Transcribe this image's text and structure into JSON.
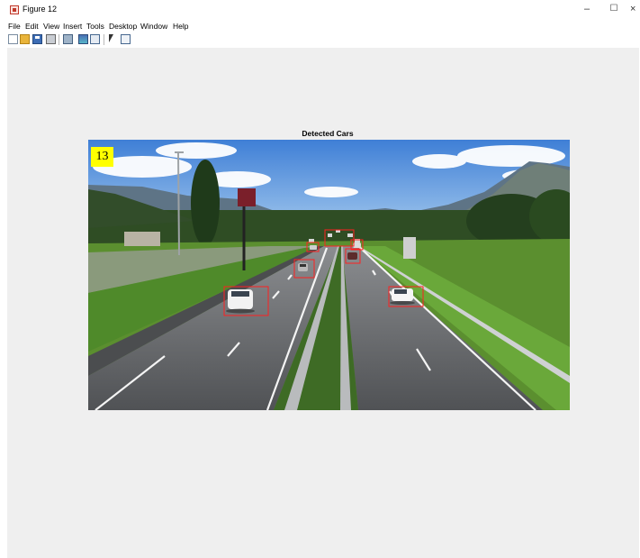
{
  "window": {
    "title": "Figure 12",
    "minimize_glyph": "–",
    "maximize_glyph": "☐",
    "close_glyph": "×"
  },
  "menu": {
    "items": [
      "File",
      "Edit",
      "View",
      "Insert",
      "Tools",
      "Desktop",
      "Window",
      "Help"
    ]
  },
  "toolbar": {
    "icons": [
      "new-figure-icon",
      "open-file-icon",
      "save-icon",
      "print-icon",
      "link-plot-icon",
      "insert-colorbar-icon",
      "insert-legend-icon",
      "edit-plot-pointer-icon",
      "show-plot-tools-icon"
    ]
  },
  "axes": {
    "title": "Detected Cars",
    "frame_label": "13",
    "detections_shown": 7,
    "box_color": "#ff2020",
    "label_background": "#ffff00"
  }
}
